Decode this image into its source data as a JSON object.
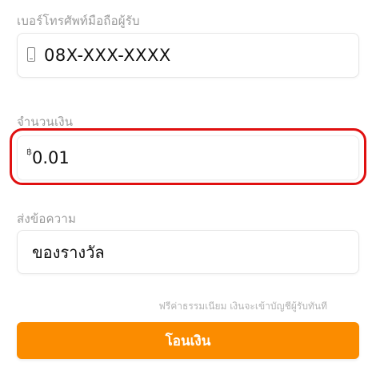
{
  "recipient_phone": {
    "label": "เบอร์โทรศัพท์มือถือผู้รับ",
    "icon": "mobile-phone-icon",
    "value": "08X-XXX-XXXX"
  },
  "amount": {
    "label": "จำนวนเงิน",
    "currency_symbol": "฿",
    "value": "0.01"
  },
  "message": {
    "label": "ส่งข้อความ",
    "value": "ของรางวัล"
  },
  "note": "ฟรีค่าธรรมเนียม เงินจะเข้าบัญชีผู้รับทันที",
  "transfer_button": {
    "label": "โอนเงิน"
  },
  "colors": {
    "accent": "#fb8c00",
    "highlight": "#e01010"
  }
}
